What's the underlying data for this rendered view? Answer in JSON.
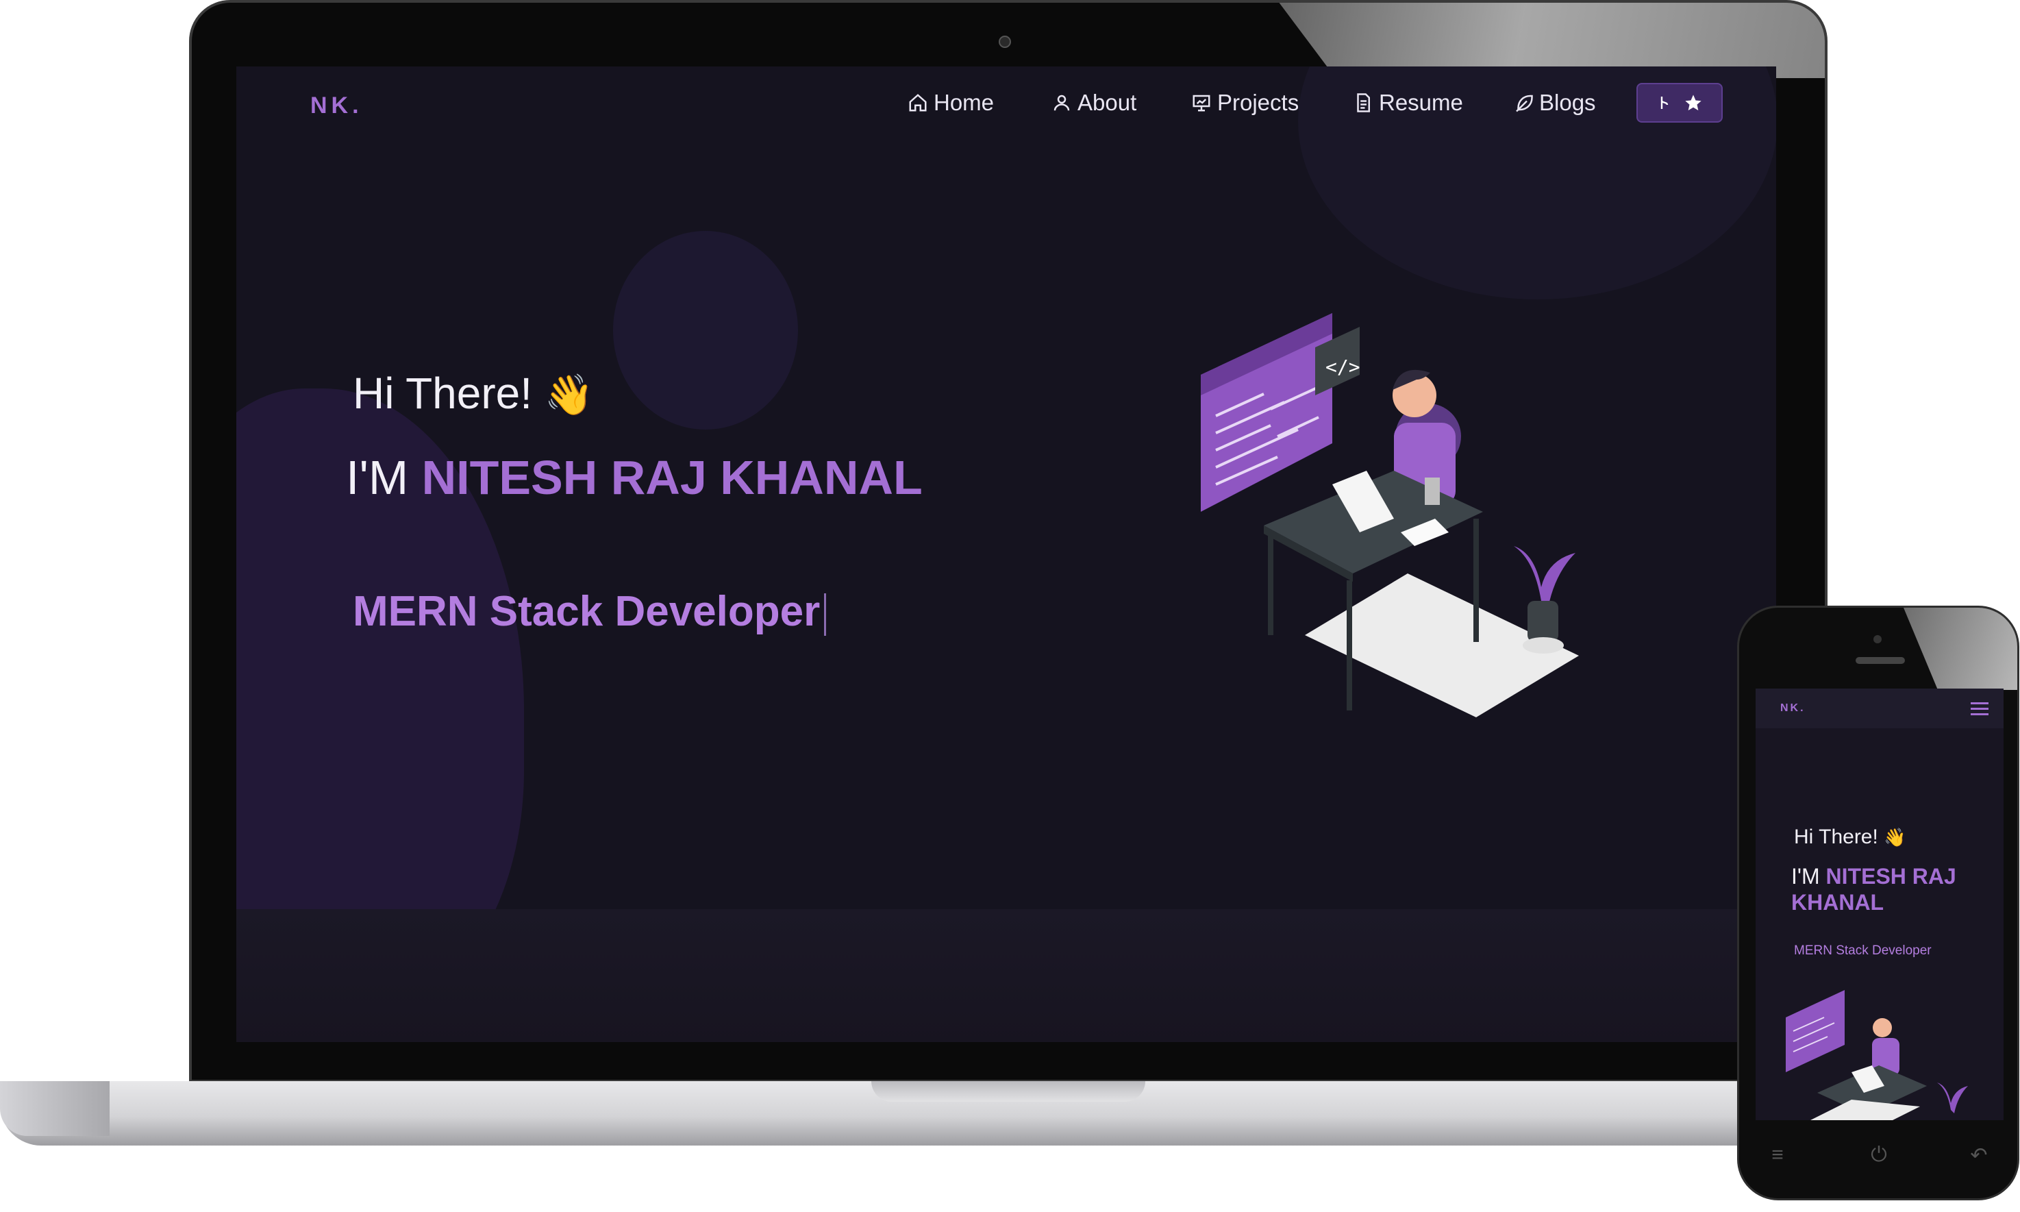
{
  "site": {
    "logo": "NK.",
    "nav": [
      {
        "label": "Home",
        "icon": "home-icon"
      },
      {
        "label": "About",
        "icon": "user-icon"
      },
      {
        "label": "Projects",
        "icon": "presentation-icon"
      },
      {
        "label": "Resume",
        "icon": "document-icon"
      },
      {
        "label": "Blogs",
        "icon": "feather-icon"
      }
    ],
    "github_button": {
      "icons": [
        "fork-icon",
        "star-icon"
      ]
    },
    "hero": {
      "greeting": "Hi There!",
      "greeting_emoji": "👋",
      "name_prefix": "I'M ",
      "name": "NITESH RAJ KHANAL",
      "role": "MERN Stack Developer"
    }
  },
  "mobile": {
    "logo": "NK.",
    "greeting": "Hi There!",
    "greeting_emoji": "👋",
    "name_prefix": "I'M ",
    "name": "NITESH RAJ KHANAL",
    "role": "MERN Stack Developer"
  },
  "colors": {
    "accent": "#a46fd4",
    "background": "#15131f",
    "button": "#3f2a64"
  }
}
